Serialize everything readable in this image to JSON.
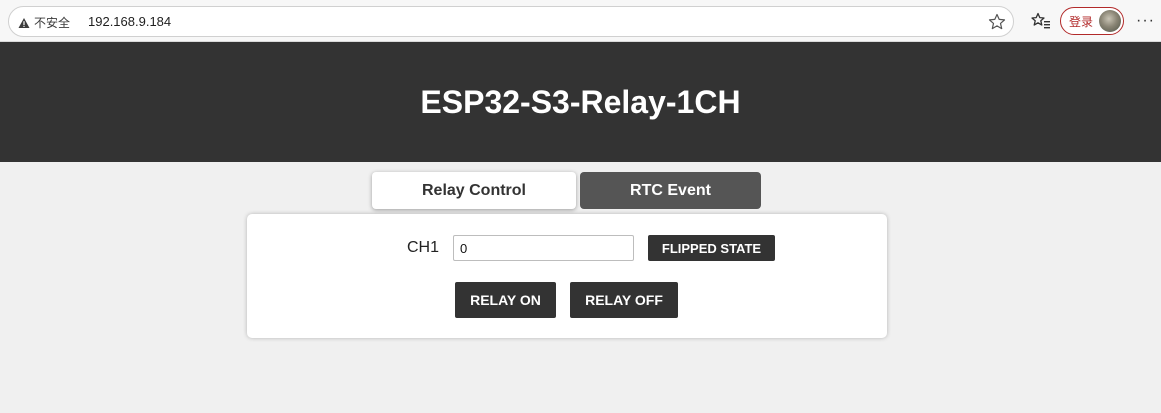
{
  "browser": {
    "security_label": "不安全",
    "url": "192.168.9.184",
    "login_label": "登录",
    "more_glyph": "···"
  },
  "header": {
    "title": "ESP32-S3-Relay-1CH"
  },
  "tabs": [
    {
      "label": "Relay Control",
      "active": true
    },
    {
      "label": "RTC Event",
      "active": false
    }
  ],
  "relay": {
    "channel_label": "CH1",
    "input_value": "0",
    "flipped_label": "FLIPPED STATE",
    "on_label": "RELAY ON",
    "off_label": "RELAY OFF"
  },
  "colors": {
    "header_bg": "#333333",
    "page_bg": "#f0f0f0",
    "inactive_tab_bg": "#555555",
    "button_bg": "#333333",
    "login_accent": "#b22a2a"
  }
}
